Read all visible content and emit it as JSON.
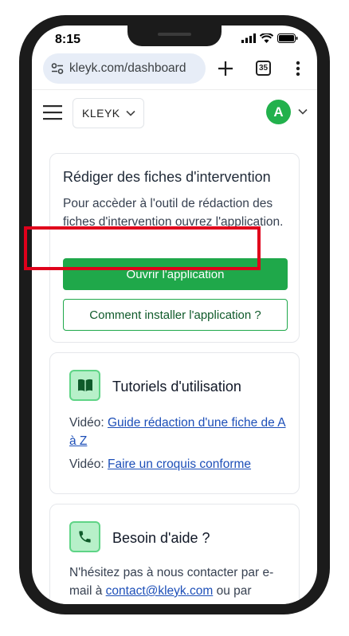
{
  "status": {
    "time": "8:15"
  },
  "browser": {
    "url": "kleyk.com/dashboard",
    "tab_count": "35"
  },
  "header": {
    "brand": "KLEYK",
    "avatar_initial": "A"
  },
  "card_interventions": {
    "title": "Rédiger des fiches d'intervention",
    "text": "Pour accèder à l'outil de rédaction des fiches d'intervention ouvrez l'application.",
    "open_button": "Ouvrir l'application",
    "install_button": "Comment installer l'application ?"
  },
  "card_tutorials": {
    "title": "Tutoriels d'utilisation",
    "items": [
      {
        "prefix": "Vidéo: ",
        "link": "Guide rédaction d'une fiche de A à Z"
      },
      {
        "prefix": "Vidéo: ",
        "link": "Faire un croquis conforme"
      }
    ]
  },
  "card_help": {
    "title": "Besoin d'aide ?",
    "text_before": "N'hésitez pas à nous contacter par e-mail à ",
    "email": "contact@kleyk.com",
    "text_after": " ou par"
  },
  "colors": {
    "accent": "#1fa84a",
    "highlight": "#e0001b",
    "link": "#1d4fb8"
  }
}
